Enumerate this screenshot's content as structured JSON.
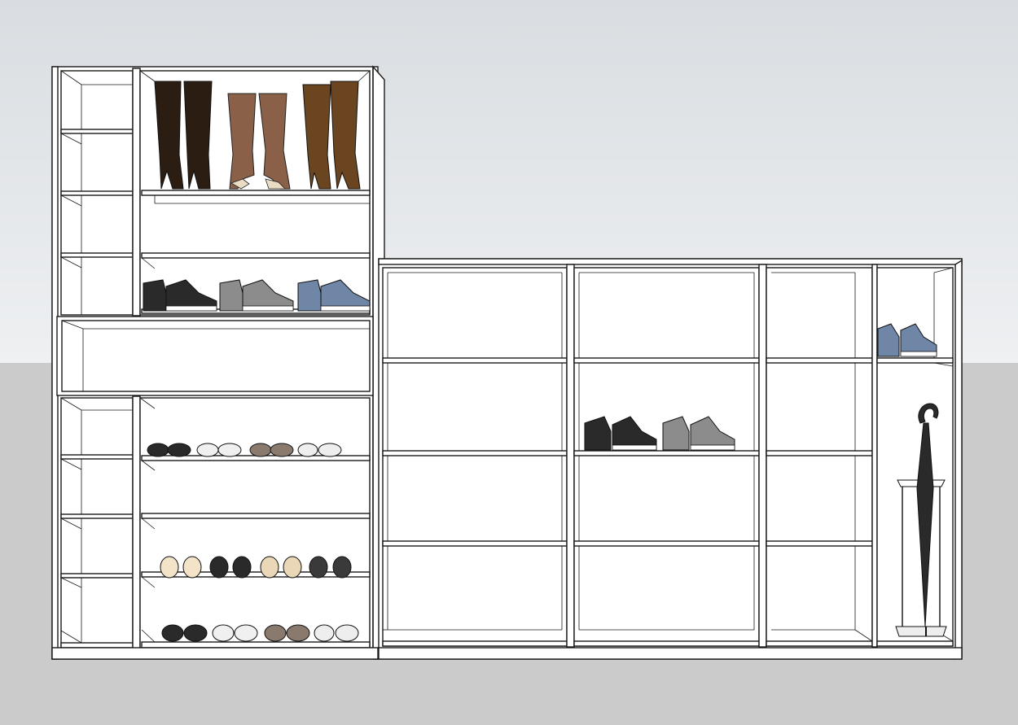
{
  "colors": {
    "wall": "#e3e6e9",
    "floor": "#cbcbcb",
    "cabinet": "#ffffff",
    "outline": "#1a1a1a",
    "boot_dark": "#2b1d12",
    "boot_tan": "#8a6048",
    "boot_brown": "#6b4520",
    "sneaker_black": "#2a2a2a",
    "sneaker_grey": "#8c8c8c",
    "sneaker_blue": "#6f86a6",
    "umbrella": "#2a2a2a"
  },
  "scene": {
    "objects": [
      {
        "name": "tall-cabinet",
        "kind": "cabinet"
      },
      {
        "name": "low-cabinet",
        "kind": "cabinet"
      },
      {
        "name": "boots",
        "kind": "shoes",
        "count": 3
      },
      {
        "name": "sneakers",
        "kind": "shoes",
        "count": 6
      },
      {
        "name": "slippers",
        "kind": "shoes",
        "count": 8
      },
      {
        "name": "umbrella-stand",
        "kind": "accessory"
      }
    ]
  }
}
